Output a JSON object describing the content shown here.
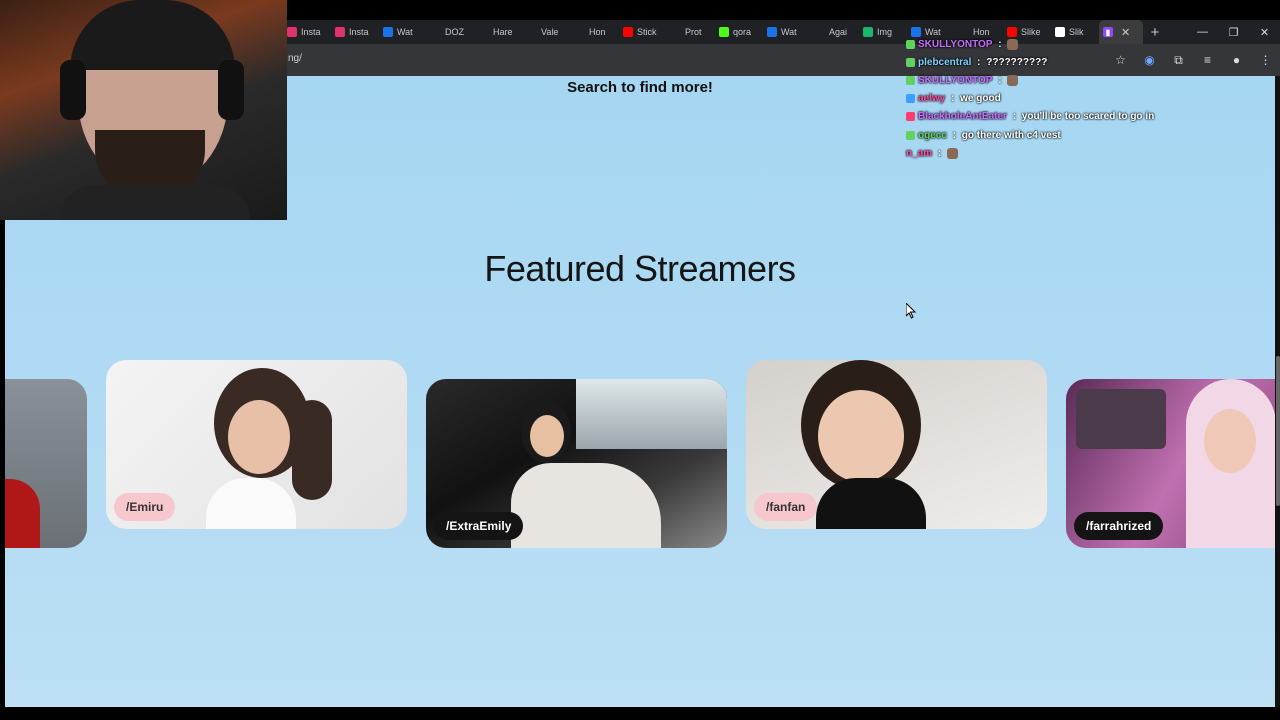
{
  "browser": {
    "tabs": [
      {
        "label": "Insta",
        "icon": "instagram-icon",
        "color": "#e1306c"
      },
      {
        "label": "Insta",
        "icon": "instagram-icon",
        "color": "#e1306c"
      },
      {
        "label": "Wat",
        "icon": "globe-icon",
        "color": "#1a73e8"
      },
      {
        "label": "DOZ",
        "icon": "x-icon",
        "color": "#202124"
      },
      {
        "label": "Hare",
        "icon": "x-icon",
        "color": "#202124"
      },
      {
        "label": "Vale",
        "icon": "x-icon",
        "color": "#202124"
      },
      {
        "label": "Hon",
        "icon": "x-icon",
        "color": "#202124"
      },
      {
        "label": "Stick",
        "icon": "youtube-icon",
        "color": "#ff0000"
      },
      {
        "label": "Prot",
        "icon": "tiktok-icon",
        "color": "#202124"
      },
      {
        "label": "qora",
        "icon": "kick-icon",
        "color": "#53fc18"
      },
      {
        "label": "Wat",
        "icon": "globe-icon",
        "color": "#1a73e8"
      },
      {
        "label": "Agai",
        "icon": "tiktok-icon",
        "color": "#202124"
      },
      {
        "label": "Img",
        "icon": "imgur-icon",
        "color": "#1bb76e"
      },
      {
        "label": "Wat",
        "icon": "globe-icon",
        "color": "#1a73e8"
      },
      {
        "label": "Hon",
        "icon": "x-icon",
        "color": "#202124"
      },
      {
        "label": "Slike",
        "icon": "youtube-icon",
        "color": "#ff0000"
      },
      {
        "label": "Slik",
        "icon": "site-icon",
        "color": "#ffffff"
      }
    ],
    "active_tab": {
      "label": "",
      "icon": "twitch-icon",
      "color": "#9146ff"
    },
    "url": "ng/"
  },
  "page": {
    "search_more": "Search to find more!",
    "featured_title": "Featured Streamers",
    "streamers": [
      {
        "name": ""
      },
      {
        "name": "/Emiru"
      },
      {
        "name": "/ExtraEmily"
      },
      {
        "name": "/fanfan"
      },
      {
        "name": "/farrahrized"
      }
    ]
  },
  "chat": [
    {
      "user": "SKULLYONTOP",
      "user_color": "#c86bff",
      "sep": " : ",
      "message": "",
      "badge_color": "#5fd35f",
      "emote": true
    },
    {
      "user": "plebcentral",
      "user_color": "#7fd1ff",
      "sep": " : ",
      "message": "??????????",
      "badge_color": "#5fd35f",
      "emote": false
    },
    {
      "user": "SKULLYONTOP",
      "user_color": "#c86bff",
      "sep": " : ",
      "message": "",
      "badge_color": "#5fd35f",
      "emote": true
    },
    {
      "user": "aelwy",
      "user_color": "#ff4fa3",
      "sep": " : ",
      "message": "we good",
      "badge_color": "#3aa0ff",
      "emote": false
    },
    {
      "user": "BlackholeAntEater",
      "user_color": "#c86bff",
      "sep": " : ",
      "message": "you'll be too scared to go in",
      "badge_color": "#ff3b6b",
      "emote": false
    },
    {
      "user": "ogecc",
      "user_color": "#5fd35f",
      "sep": " : ",
      "message": "go there with c4 vest",
      "badge_color": "#5fd35f",
      "emote": false
    },
    {
      "user": "n_am",
      "user_color": "#ff4fa3",
      "sep": " : ",
      "message": "",
      "badge_color": "",
      "emote": true
    }
  ],
  "colors": {
    "page_bg": "#a5d6f2",
    "name_tag_pink": "#f7c7ce",
    "name_tag_dark": "#141414"
  }
}
